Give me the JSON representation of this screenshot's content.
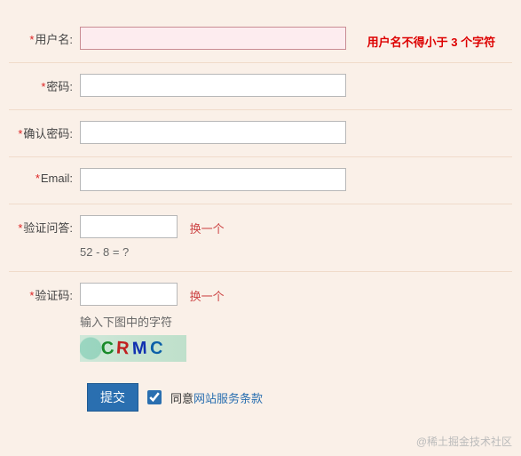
{
  "fields": {
    "username": {
      "label": "用户名:",
      "value": "",
      "error": "用户名不得小于 3 个字符"
    },
    "password": {
      "label": "密码:",
      "value": ""
    },
    "password2": {
      "label": "确认密码:",
      "value": ""
    },
    "email": {
      "label": "Email:",
      "value": ""
    },
    "secqa": {
      "label": "验证问答:",
      "value": "",
      "swap": "换一个",
      "question": "52 - 8 = ?"
    },
    "captcha": {
      "label": "验证码:",
      "value": "",
      "swap": "换一个",
      "hint": "输入下图中的字符",
      "chars": [
        "C",
        "R",
        "M",
        "C"
      ]
    }
  },
  "submit": {
    "button": "提交",
    "agree_prefix": "同意",
    "agree_link": "网站服务条款",
    "checked": true
  },
  "watermark": "@稀土掘金技术社区"
}
